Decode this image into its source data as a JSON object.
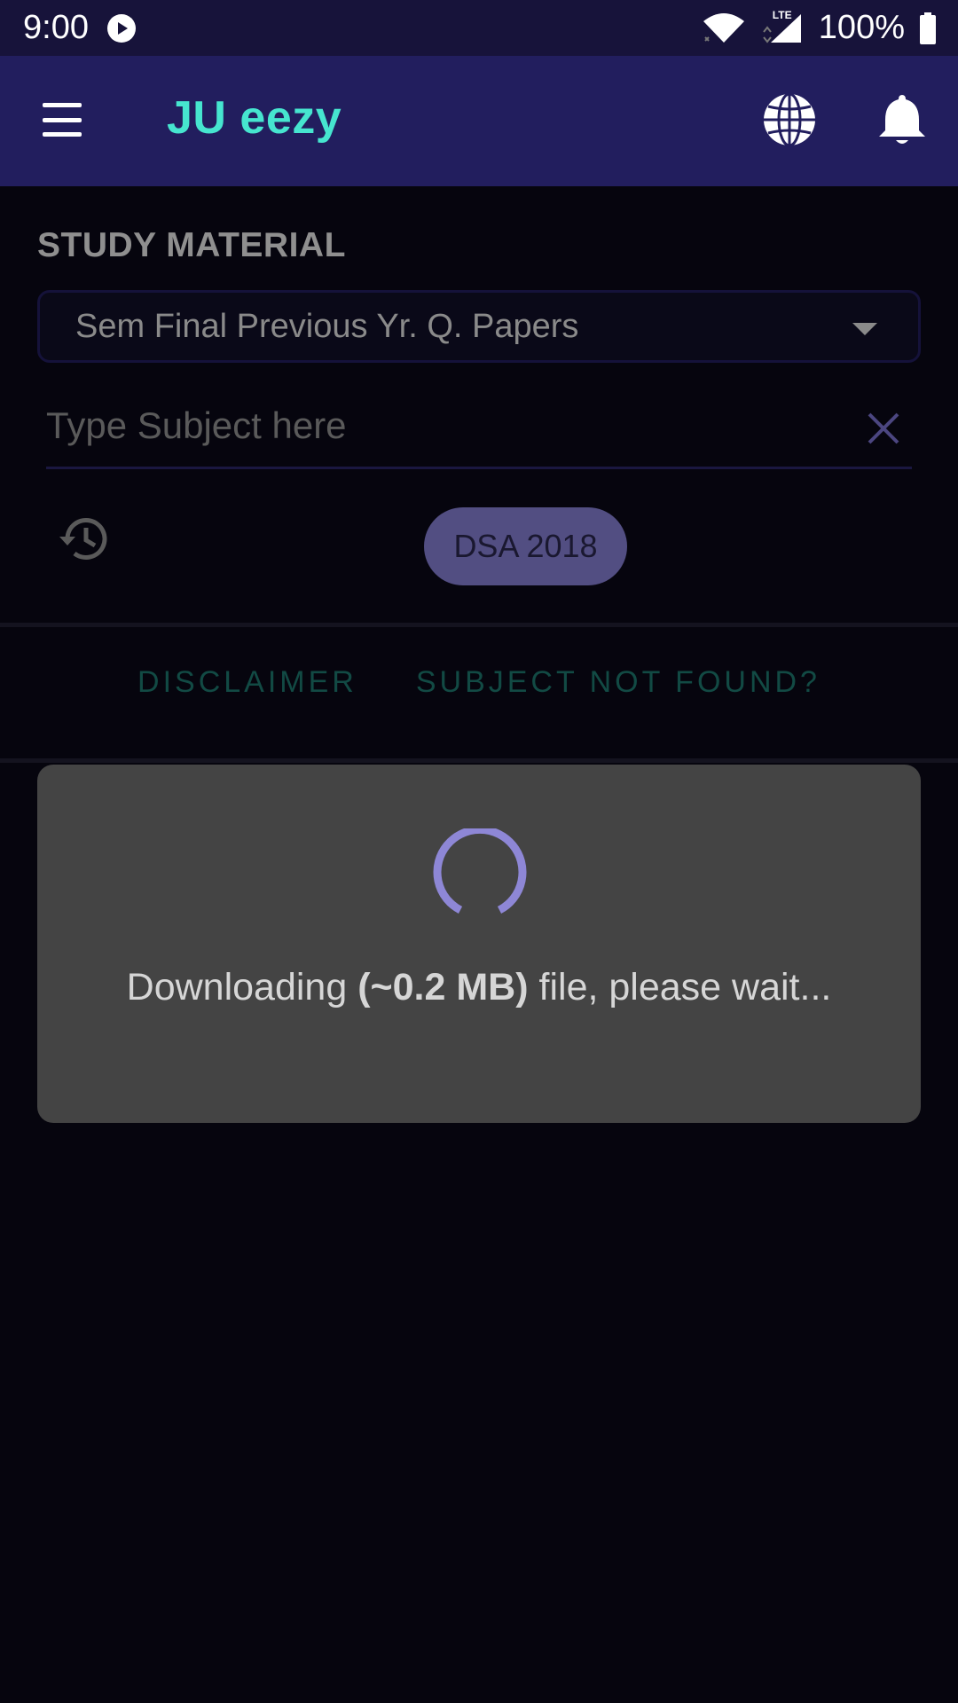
{
  "status_bar": {
    "time": "9:00",
    "network_label": "LTE",
    "battery": "100%"
  },
  "app_bar": {
    "title": "JU eezy",
    "icons": [
      "menu-icon",
      "globe-icon",
      "bell-icon"
    ]
  },
  "content": {
    "section_title": "STUDY MATERIAL",
    "material_type": "Sem Final Previous Yr. Q. Papers",
    "search": {
      "value": "",
      "placeholder": "Type Subject here"
    },
    "recent_chip": "DSA 2018",
    "links": {
      "disclaimer": "DISCLAIMER",
      "subject_not_found": "SUBJECT NOT FOUND?"
    }
  },
  "dialog": {
    "text_prefix": "Downloading ",
    "file_size": "(~0.2 MB)",
    "text_suffix": " file, please wait..."
  },
  "colors": {
    "status_bar_bg": "#17133a",
    "app_bar_bg": "#221e5e",
    "title_accent": "#46e5cf",
    "page_bg": "#06050e",
    "dialog_bg": "#444444",
    "spinner": "#8e87d6",
    "chip_bg": "#524e82"
  }
}
